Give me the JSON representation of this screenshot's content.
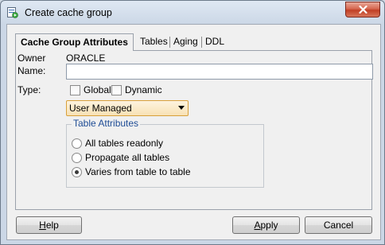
{
  "window": {
    "title": "Create cache group",
    "close_icon": "close-icon"
  },
  "tabs": [
    {
      "label": "Cache Group Attributes",
      "active": true
    },
    {
      "label": "Tables",
      "active": false
    },
    {
      "label": "Aging",
      "active": false
    },
    {
      "label": "DDL",
      "active": false
    }
  ],
  "form": {
    "owner_label": "Owner",
    "owner_value": "ORACLE",
    "name_label": "Name:",
    "name_value": "",
    "type_label": "Type:",
    "global_label": "Global",
    "global_checked": false,
    "dynamic_label": "Dynamic",
    "dynamic_checked": false,
    "cache_type_selected": "User Managed"
  },
  "table_attributes": {
    "legend": "Table Attributes",
    "options": [
      {
        "label": "All tables readonly",
        "selected": false
      },
      {
        "label": "Propagate all tables",
        "selected": false
      },
      {
        "label": "Varies from table to table",
        "selected": true
      }
    ]
  },
  "buttons": {
    "help_first": "H",
    "help_rest": "elp",
    "apply_first": "A",
    "apply_rest": "pply",
    "cancel": "Cancel"
  }
}
